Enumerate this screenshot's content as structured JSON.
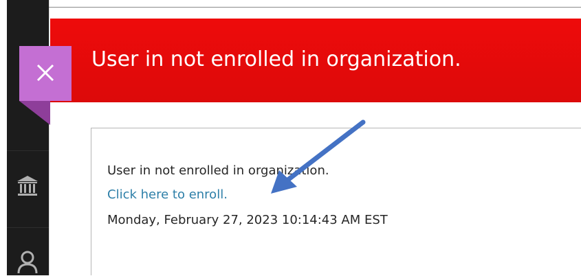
{
  "banner": {
    "title": "User in not enrolled in organization."
  },
  "close_button": {
    "label": "×",
    "icon": "close-icon",
    "color": "#c46fd3"
  },
  "message": {
    "line1": "User in not enrolled in organization.",
    "enroll_link": "Click here to enroll.",
    "timestamp": "Monday, February 27, 2023 10:14:43 AM EST"
  },
  "nav_rail": {
    "items": [
      {
        "icon": "institution-icon"
      },
      {
        "icon": "user-icon"
      }
    ]
  },
  "colors": {
    "banner": "#e60b0b",
    "link": "#2d7fa8",
    "nav_rail": "#1c1c1c",
    "annotation_arrow": "#4472c4"
  }
}
